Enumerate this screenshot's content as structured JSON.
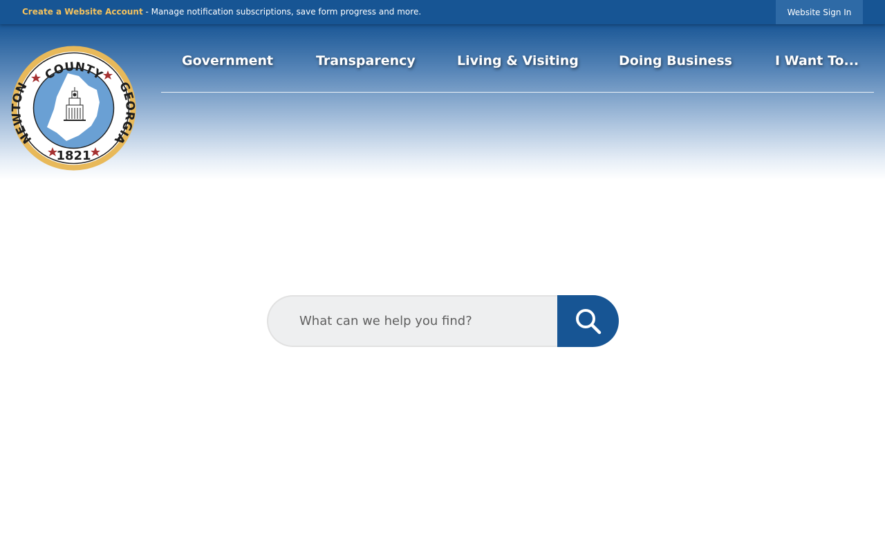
{
  "topbar": {
    "create_account_label": "Create a Website Account",
    "message": " - Manage notification subscriptions, save form progress and more.",
    "signin_label": "Website Sign In"
  },
  "logo": {
    "text_top": "COUNTY",
    "text_left": "NEWTON",
    "text_right": "GEORGIA",
    "year": "1821"
  },
  "nav": {
    "items": [
      {
        "label": "Government"
      },
      {
        "label": "Transparency"
      },
      {
        "label": "Living & Visiting"
      },
      {
        "label": "Doing Business"
      },
      {
        "label": "I Want To..."
      }
    ]
  },
  "search": {
    "placeholder": "What can we help you find?",
    "icon": "search-icon"
  },
  "colors": {
    "brand_blue": "#175594",
    "accent_gold": "#f4c25e",
    "seal_gold": "#e8b95a",
    "seal_star_red": "#a63232",
    "seal_inner_blue": "#6aa0d4"
  }
}
